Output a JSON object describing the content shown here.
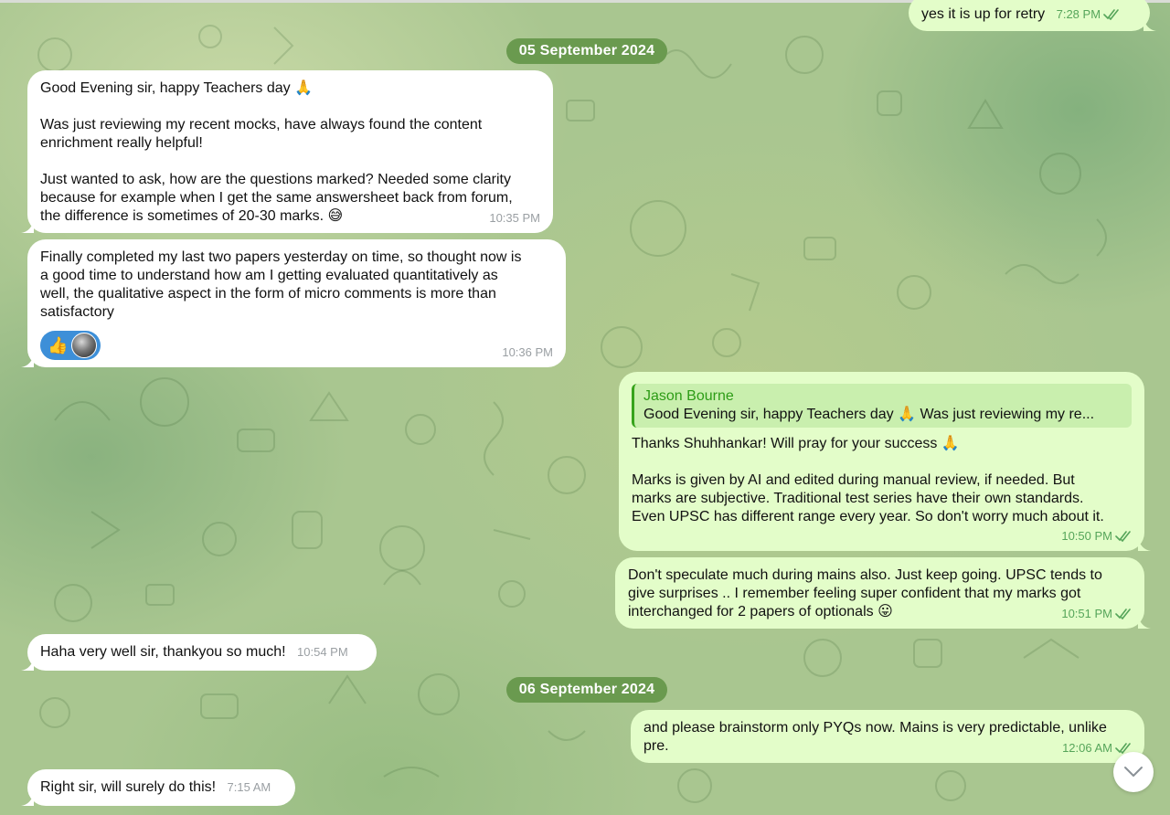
{
  "colors": {
    "incoming_bubble": "#ffffff",
    "outgoing_bubble": "#e3fdc9",
    "date_pill": "#6a9a4f",
    "reply_accent": "#37a31c",
    "reaction_pill": "#3d8fd8",
    "read_check": "#56a55a"
  },
  "date_separators": [
    "05 September 2024",
    "06 September 2024"
  ],
  "messages": [
    {
      "direction": "out",
      "text": "yes it is up for retry",
      "time": "7:28 PM",
      "status_icon": "double-check-icon"
    },
    {
      "direction": "in",
      "text": "Good Evening sir, happy Teachers day 🙏\n\nWas just reviewing my recent mocks, have always found the content\nenrichment really helpful!\n\nJust wanted to ask, how are the questions marked? Needed some clarity\nbecause for example when I get the same answersheet back from forum,\nthe difference is sometimes of 20-30 marks. 😅",
      "time": "10:35 PM"
    },
    {
      "direction": "in",
      "text": "Finally completed my last two papers yesterday on time, so thought now is\na good time to understand how am I getting evaluated quantitatively as\nwell, the qualitative aspect in the form of micro comments is more than\nsatisfactory",
      "time": "10:36 PM",
      "reaction": {
        "emoji": "👍",
        "reactor": "avatar"
      }
    },
    {
      "direction": "out",
      "reply_to": {
        "name": "Jason Bourne",
        "text": "Good Evening sir, happy Teachers day 🙏  Was just reviewing my re..."
      },
      "text": "Thanks Shuhhankar! Will pray for your success 🙏\n\nMarks is given by AI and edited during manual review, if needed. But\nmarks are subjective. Traditional test series have their own standards.\nEven UPSC has different range every year. So don't worry much about it.",
      "time": "10:50 PM",
      "status_icon": "double-check-icon"
    },
    {
      "direction": "out",
      "text": "Don't speculate much during mains also. Just keep going. UPSC tends to\ngive surprises .. I remember feeling super confident that my marks got\ninterchanged for 2 papers of optionals 😛",
      "time": "10:51 PM",
      "status_icon": "double-check-icon"
    },
    {
      "direction": "in",
      "text": "Haha very well sir, thankyou so much!",
      "time": "10:54 PM"
    },
    {
      "direction": "out",
      "text": "and please brainstorm only PYQs now. Mains is very predictable, unlike\npre.",
      "time": "12:06 AM",
      "status_icon": "double-check-icon"
    },
    {
      "direction": "in",
      "text": "Right sir, will surely do this!",
      "time": "7:15 AM"
    }
  ],
  "scroll_button": {
    "icon": "chevron-down-icon"
  }
}
